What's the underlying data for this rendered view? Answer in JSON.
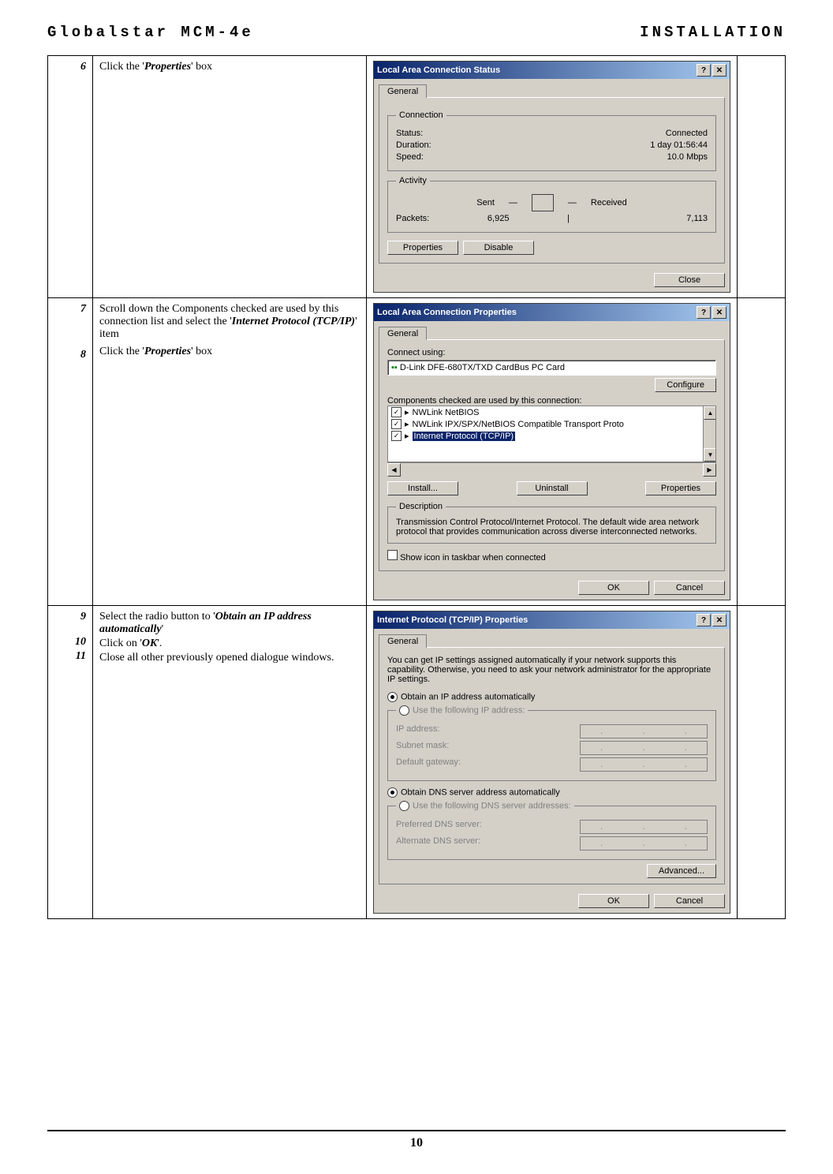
{
  "header": {
    "left": "Globalstar MCM-4e",
    "right": "INSTALLATION"
  },
  "footer": {
    "page_number": "10"
  },
  "rows": [
    {
      "steps": [
        {
          "num": "6",
          "text_pre": "Click the '",
          "bold": "Properties",
          "text_post": "' box"
        }
      ],
      "dialog": {
        "title": "Local Area Connection Status",
        "help": "?",
        "close": "✕",
        "tab": "General",
        "connection": {
          "legend": "Connection",
          "status_label": "Status:",
          "status_value": "Connected",
          "duration_label": "Duration:",
          "duration_value": "1 day 01:56:44",
          "speed_label": "Speed:",
          "speed_value": "10.0 Mbps"
        },
        "activity": {
          "legend": "Activity",
          "sent_label": "Sent",
          "received_label": "Received",
          "packets_label": "Packets:",
          "sent_value": "6,925",
          "received_value": "7,113"
        },
        "buttons": {
          "properties": "Properties",
          "disable": "Disable",
          "close": "Close"
        }
      }
    },
    {
      "steps": [
        {
          "num": "7",
          "text_pre": "Scroll down the Components checked are used by this connection list and select the '",
          "bold": "Internet Protocol (TCP/IP)",
          "text_post": "' item"
        },
        {
          "num": "8",
          "text_pre": "Click the '",
          "bold": "Properties",
          "text_post": "' box"
        }
      ],
      "dialog": {
        "title": "Local Area Connection Properties",
        "help": "?",
        "close": "✕",
        "tab": "General",
        "connect_using_label": "Connect using:",
        "adapter": "D-Link DFE-680TX/TXD CardBus PC Card",
        "configure_btn": "Configure",
        "components_label": "Components checked are used by this connection:",
        "components": [
          "NWLink NetBIOS",
          "NWLink IPX/SPX/NetBIOS Compatible Transport Proto",
          "Internet Protocol (TCP/IP)"
        ],
        "btns": {
          "install": "Install...",
          "uninstall": "Uninstall",
          "properties": "Properties"
        },
        "description": {
          "legend": "Description",
          "text": "Transmission Control Protocol/Internet Protocol. The default wide area network protocol that provides communication across diverse interconnected networks."
        },
        "show_icon": "Show icon in taskbar when connected",
        "ok": "OK",
        "cancel": "Cancel"
      }
    },
    {
      "steps": [
        {
          "num": "9",
          "text_pre": "Select the radio button to '",
          "bold": "Obtain an IP address automatically",
          "text_post": "'"
        },
        {
          "num": "10",
          "text_pre": "Click on '",
          "bold": "OK",
          "text_post": "'."
        },
        {
          "num": "11",
          "text_pre": "Close all other previously opened dialogue windows.",
          "bold": "",
          "text_post": ""
        }
      ],
      "dialog": {
        "title": "Internet Protocol (TCP/IP) Properties",
        "help": "?",
        "close": "✕",
        "tab": "General",
        "intro": "You can get IP settings assigned automatically if your network supports this capability. Otherwise, you need to ask your network administrator for the appropriate IP settings.",
        "radio_auto_ip": "Obtain an IP address automatically",
        "radio_use_ip": "Use the following IP address:",
        "ip_label": "IP address:",
        "subnet_label": "Subnet mask:",
        "gateway_label": "Default gateway:",
        "radio_auto_dns": "Obtain DNS server address automatically",
        "radio_use_dns": "Use the following DNS server addresses:",
        "pref_dns": "Preferred DNS server:",
        "alt_dns": "Alternate DNS server:",
        "advanced": "Advanced...",
        "ok": "OK",
        "cancel": "Cancel"
      }
    }
  ]
}
